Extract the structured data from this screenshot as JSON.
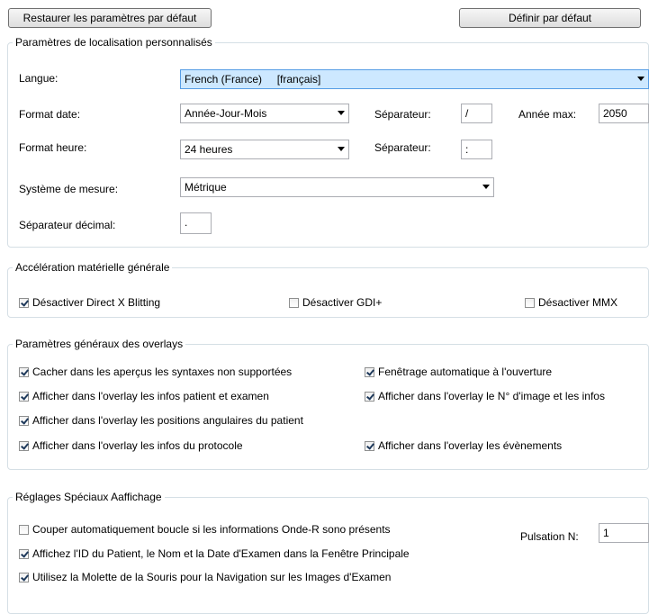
{
  "toolbar": {
    "restore_label": "Restaurer les paramètres par défaut",
    "set_default_label": "Définir par défaut"
  },
  "localization": {
    "title": "Paramètres de localisation personnalisés",
    "language_label": "Langue:",
    "language_value": "French (France)     [français]",
    "date_format_label": "Format date:",
    "date_format_value": "Année-Jour-Mois",
    "date_separator_label": "Séparateur:",
    "date_separator_value": "/",
    "max_year_label": "Année max:",
    "max_year_value": "2050",
    "time_format_label": "Format heure:",
    "time_format_value": "24 heures",
    "time_separator_label": "Séparateur:",
    "time_separator_value": ":",
    "measure_label": "Système de mesure:",
    "measure_value": "Métrique",
    "decimal_label": "Séparateur décimal:",
    "decimal_value": "."
  },
  "hardware": {
    "title": "Accélération matérielle générale",
    "disable_directx": {
      "label": "Désactiver Direct X Blitting",
      "checked": true
    },
    "disable_gdi": {
      "label": "Désactiver GDI+",
      "checked": false
    },
    "disable_mmx": {
      "label": "Désactiver MMX",
      "checked": false
    }
  },
  "overlays": {
    "title": "Paramètres généraux des overlays",
    "hide_unsupported": {
      "label": "Cacher dans les aperçus les syntaxes non supportées",
      "checked": true
    },
    "auto_windowing": {
      "label": "Fenêtrage automatique à l'ouverture",
      "checked": true
    },
    "patient_exam_info": {
      "label": "Afficher dans l'overlay les infos patient et examen",
      "checked": true
    },
    "image_number_info": {
      "label": "Afficher dans l'overlay le N° d'image et les infos",
      "checked": true
    },
    "angular_positions": {
      "label": "Afficher dans l'overlay les positions angulaires du patient",
      "checked": true
    },
    "protocol_info": {
      "label": "Afficher dans l'overlay les infos du protocole",
      "checked": true
    },
    "events": {
      "label": "Afficher dans l'overlay les évènements",
      "checked": true
    }
  },
  "special": {
    "title": "Réglages Spéciaux Aaffichage",
    "cut_loop": {
      "label": "Couper automatiquement boucle si les informations Onde-R sono présents",
      "checked": false
    },
    "pulse_label": "Pulsation N:",
    "pulse_value": "1",
    "show_patient_id": {
      "label": "Affichez l'ID du Patient, le Nom et la Date d'Examen dans la Fenêtre Principale",
      "checked": true
    },
    "mouse_wheel": {
      "label": "Utilisez la Molette de la Souris pour la Navigation sur les Images d'Examen",
      "checked": true
    }
  }
}
